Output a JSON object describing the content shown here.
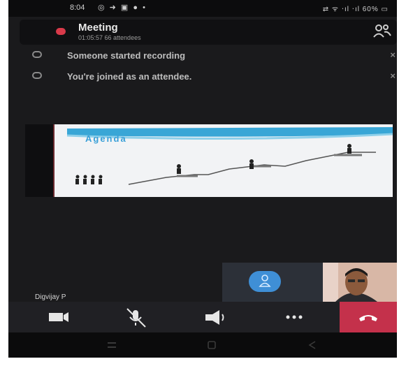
{
  "status_bar": {
    "time": "8:04",
    "left_icons": "◎ ➜ ▣ ● •",
    "right_text": "⇄ ᯤ ‧ıl ‧ıl 60% ▭"
  },
  "meeting": {
    "title": "Meeting",
    "duration": "01:05:57",
    "attendees": "66 attendees",
    "subtitle": "01:05:57 66 attendees"
  },
  "notifications": [
    {
      "text": "Someone started recording",
      "close": "×"
    },
    {
      "text": "You're joined as an attendee.",
      "close": "×"
    }
  ],
  "slide": {
    "title": "Agenda"
  },
  "participant": {
    "name": "Digvijay P"
  },
  "controls": {
    "end_call": "⏚"
  },
  "colors": {
    "end_call": "#c4314b",
    "recording": "#d93a4a",
    "accent_blue": "#3f8fd6"
  }
}
